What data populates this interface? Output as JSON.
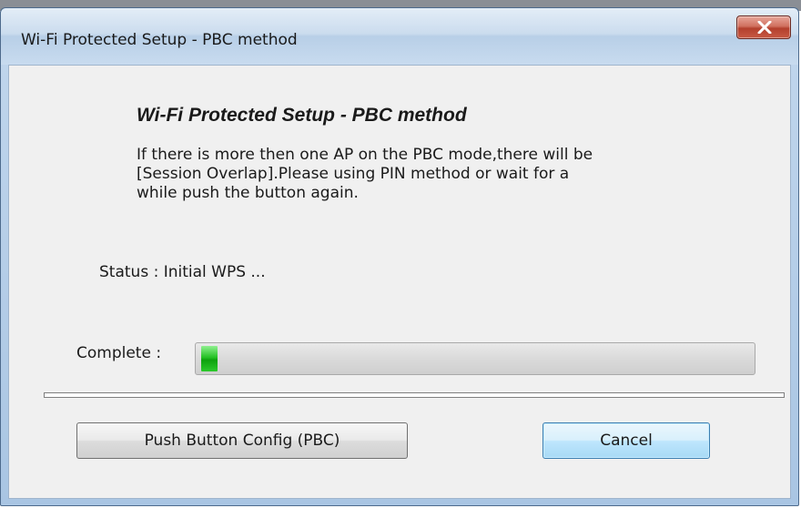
{
  "window": {
    "title": "Wi-Fi Protected Setup - PBC method",
    "close_icon": "close-x-icon"
  },
  "content": {
    "heading": "Wi-Fi Protected Setup - PBC method",
    "description_lines": [
      "If there is more then one AP on the PBC mode,there will be",
      "[Session Overlap].Please using PIN method or wait for a",
      "while push the button again."
    ],
    "status": "Status : Initial WPS ...",
    "complete_label": "Complete :",
    "progress_fraction": 0.03
  },
  "buttons": {
    "pbc_label": "Push Button Config (PBC)",
    "cancel_label": "Cancel"
  },
  "colors": {
    "progress_green": "#1cb51c",
    "close_red": "#c8503a"
  }
}
